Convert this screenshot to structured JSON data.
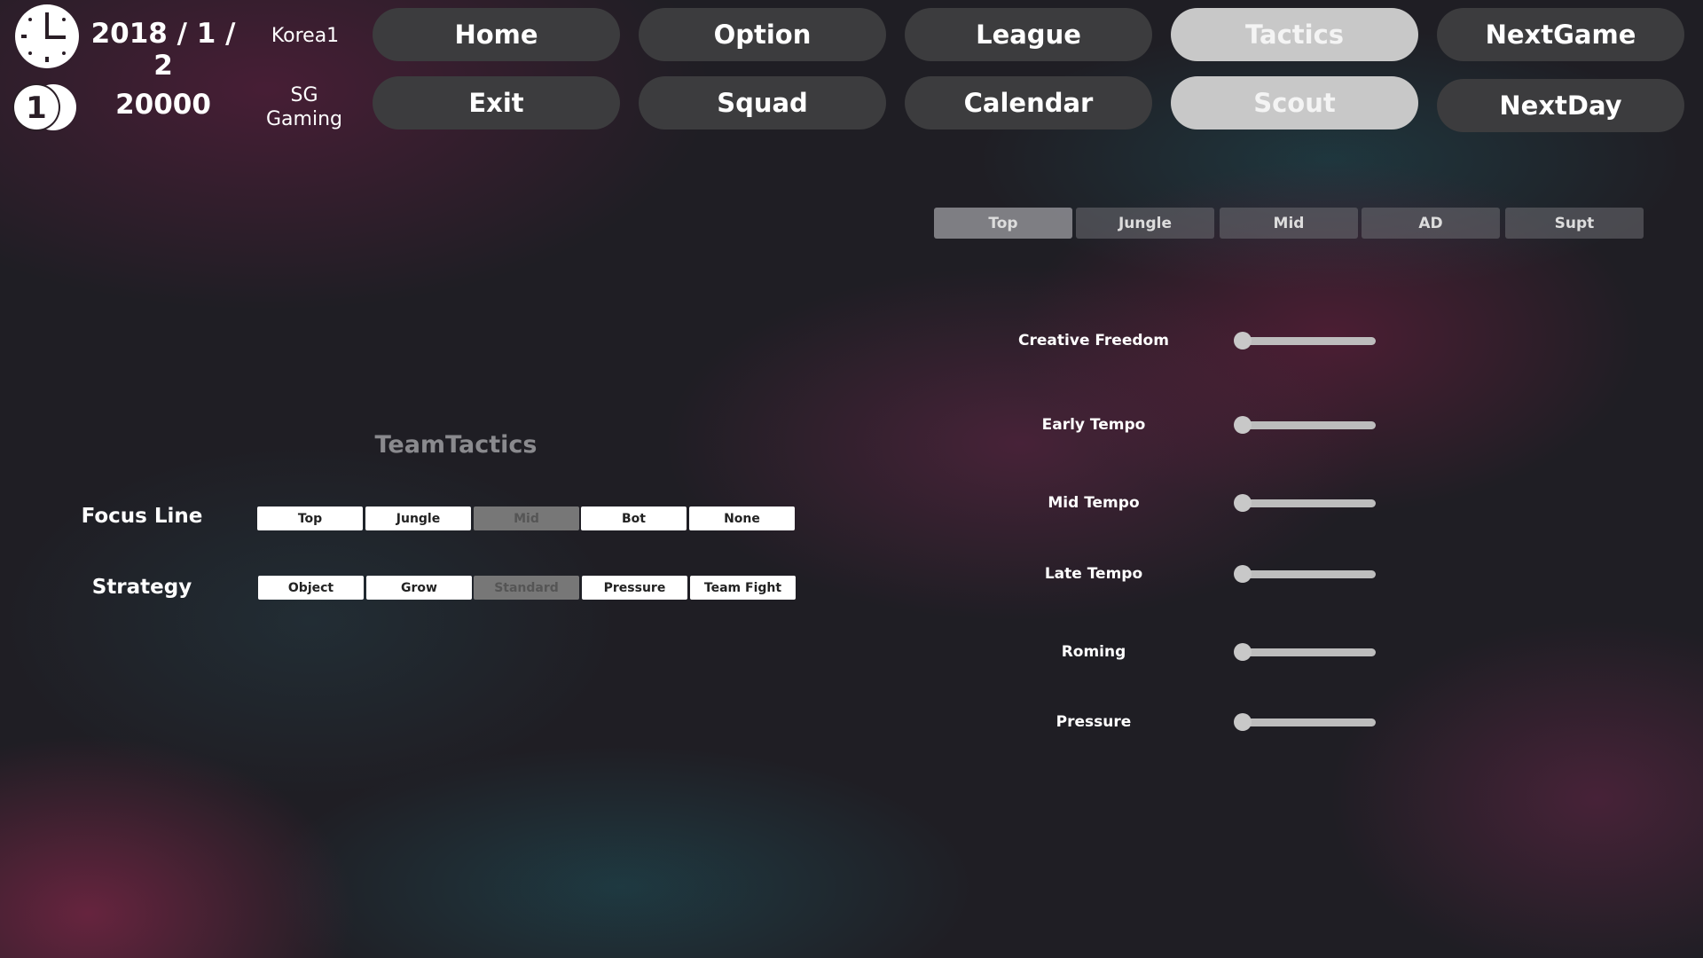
{
  "header": {
    "date": "2018 / 1 / 2",
    "league": "Korea1",
    "money": "20000",
    "team": "SG Gaming"
  },
  "nav": {
    "row1": [
      "Home",
      "Option",
      "League",
      "Tactics",
      "NextGame"
    ],
    "row2": [
      "Exit",
      "Squad",
      "Calendar",
      "Scout",
      "NextDay"
    ],
    "active": [
      "Tactics",
      "Scout"
    ]
  },
  "positions": {
    "tabs": [
      "Top",
      "Jungle",
      "Mid",
      "AD",
      "Supt"
    ],
    "selected": "Top"
  },
  "sliders": [
    {
      "label": "Creative Freedom",
      "value": 0
    },
    {
      "label": "Early Tempo",
      "value": 0
    },
    {
      "label": "Mid Tempo",
      "value": 0
    },
    {
      "label": "Late Tempo",
      "value": 0
    },
    {
      "label": "Roming",
      "value": 0
    },
    {
      "label": "Pressure",
      "value": 0
    }
  ],
  "team_tactics": {
    "title": "TeamTactics",
    "focus_line": {
      "label": "Focus Line",
      "options": [
        "Top",
        "Jungle",
        "Mid",
        "Bot",
        "None"
      ],
      "selected": "Mid"
    },
    "strategy": {
      "label": "Strategy",
      "options": [
        "Object",
        "Grow",
        "Standard",
        "Pressure",
        "Team Fight"
      ],
      "selected": "Standard"
    }
  }
}
